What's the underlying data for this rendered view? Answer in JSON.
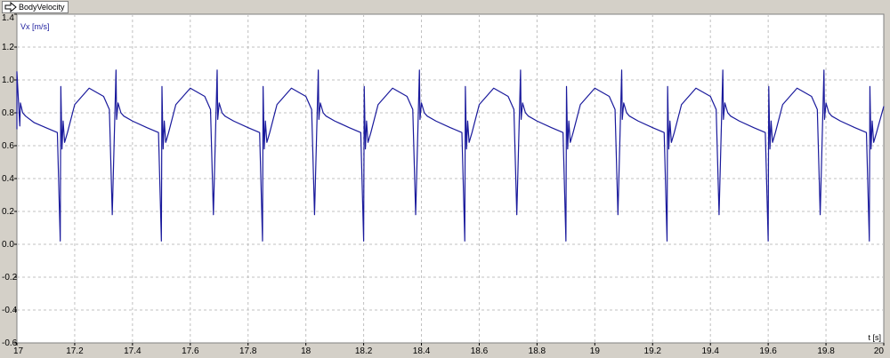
{
  "window": {
    "tab_label": "BodyVelocity"
  },
  "colors": {
    "background": "#d4d0c8",
    "plot_background": "#ffffff",
    "grid": "#c0c0c0",
    "series": "#1a1a9c"
  },
  "chart_data": {
    "type": "line",
    "title": "",
    "xlabel": "t [s]",
    "ylabel": "Vx [m/s]",
    "xlim": [
      17,
      20
    ],
    "ylim": [
      -0.6,
      1.4
    ],
    "grid": true,
    "x_ticks": [
      "17",
      "17.2",
      "17.4",
      "17.6",
      "17.8",
      "18",
      "18.2",
      "18.4",
      "18.6",
      "18.8",
      "19",
      "19.2",
      "19.4",
      "19.6",
      "19.8",
      "20"
    ],
    "y_ticks": [
      "1.4",
      "1.2",
      "1.0",
      "0.8",
      "0.6",
      "0.4",
      "0.2",
      "0.0",
      "-0.2",
      "-0.4",
      "-0.6"
    ],
    "series": [
      {
        "name": "",
        "x": [
          17.0,
          17.0,
          17.01,
          17.012,
          17.02,
          17.03,
          17.06,
          17.1,
          17.14,
          17.15,
          17.152,
          17.156,
          17.16,
          17.165,
          17.175,
          17.2,
          17.25,
          17.3,
          17.32,
          17.33,
          17.343,
          17.345,
          17.35,
          17.36,
          17.37,
          17.4,
          17.45,
          17.49,
          17.5,
          17.502,
          17.506,
          17.51,
          17.515,
          17.525,
          17.55,
          17.6,
          17.65,
          17.67,
          17.68,
          17.693,
          17.695,
          17.7,
          17.71,
          17.72,
          17.75,
          17.8,
          17.84,
          17.85,
          17.852,
          17.856,
          17.86,
          17.865,
          17.875,
          17.9,
          17.95,
          18.0,
          18.02,
          18.03,
          18.043,
          18.045,
          18.05,
          18.06,
          18.07,
          18.1,
          18.15,
          18.19,
          18.2,
          18.202,
          18.206,
          18.21,
          18.215,
          18.225,
          18.25,
          18.3,
          18.35,
          18.37,
          18.38,
          18.393,
          18.395,
          18.4,
          18.41,
          18.42,
          18.45,
          18.5,
          18.54,
          18.55,
          18.552,
          18.556,
          18.56,
          18.565,
          18.575,
          18.6,
          18.65,
          18.7,
          18.72,
          18.73,
          18.743,
          18.745,
          18.75,
          18.76,
          18.77,
          18.8,
          18.85,
          18.89,
          18.9,
          18.902,
          18.906,
          18.91,
          18.915,
          18.925,
          18.95,
          19.0,
          19.05,
          19.07,
          19.08,
          19.093,
          19.095,
          19.1,
          19.11,
          19.12,
          19.15,
          19.2,
          19.24,
          19.25,
          19.252,
          19.256,
          19.26,
          19.265,
          19.275,
          19.3,
          19.35,
          19.4,
          19.42,
          19.43,
          19.443,
          19.445,
          19.45,
          19.46,
          19.47,
          19.5,
          19.55,
          19.59,
          19.6,
          19.602,
          19.606,
          19.61,
          19.615,
          19.625,
          19.65,
          19.7,
          19.75,
          19.77,
          19.78,
          19.793,
          19.795,
          19.8,
          19.81,
          19.82,
          19.85,
          19.9,
          19.94,
          19.95,
          19.952,
          19.956,
          19.96,
          19.965,
          19.975,
          20.0
        ],
        "y": [
          0.7,
          1.05,
          0.72,
          0.86,
          0.8,
          0.78,
          0.74,
          0.71,
          0.68,
          0.02,
          0.96,
          0.58,
          0.75,
          0.62,
          0.68,
          0.85,
          0.95,
          0.9,
          0.82,
          0.18,
          1.06,
          0.76,
          0.86,
          0.8,
          0.78,
          0.75,
          0.71,
          0.68,
          0.02,
          0.96,
          0.58,
          0.75,
          0.62,
          0.68,
          0.85,
          0.95,
          0.9,
          0.82,
          0.18,
          1.06,
          0.76,
          0.86,
          0.8,
          0.78,
          0.75,
          0.71,
          0.68,
          0.02,
          0.96,
          0.58,
          0.75,
          0.62,
          0.68,
          0.85,
          0.95,
          0.9,
          0.82,
          0.18,
          1.06,
          0.76,
          0.86,
          0.8,
          0.78,
          0.75,
          0.71,
          0.68,
          0.02,
          0.96,
          0.58,
          0.75,
          0.62,
          0.68,
          0.85,
          0.95,
          0.9,
          0.82,
          0.18,
          1.06,
          0.76,
          0.86,
          0.8,
          0.78,
          0.75,
          0.71,
          0.68,
          0.02,
          0.96,
          0.58,
          0.75,
          0.62,
          0.68,
          0.85,
          0.95,
          0.9,
          0.82,
          0.18,
          1.06,
          0.76,
          0.86,
          0.8,
          0.78,
          0.75,
          0.71,
          0.68,
          0.02,
          0.96,
          0.58,
          0.75,
          0.62,
          0.68,
          0.85,
          0.95,
          0.9,
          0.82,
          0.18,
          1.06,
          0.76,
          0.86,
          0.8,
          0.78,
          0.75,
          0.71,
          0.68,
          0.02,
          0.96,
          0.58,
          0.75,
          0.62,
          0.68,
          0.85,
          0.95,
          0.9,
          0.82,
          0.18,
          1.06,
          0.76,
          0.86,
          0.8,
          0.78,
          0.75,
          0.71,
          0.68,
          0.02,
          0.96,
          0.58,
          0.75,
          0.62,
          0.68,
          0.85,
          0.95,
          0.9,
          0.82,
          0.18,
          1.06,
          0.76,
          0.86,
          0.8,
          0.78,
          0.75,
          0.71,
          0.68,
          0.02,
          0.96,
          0.58,
          0.75,
          0.62,
          0.68,
          0.84
        ]
      }
    ]
  }
}
